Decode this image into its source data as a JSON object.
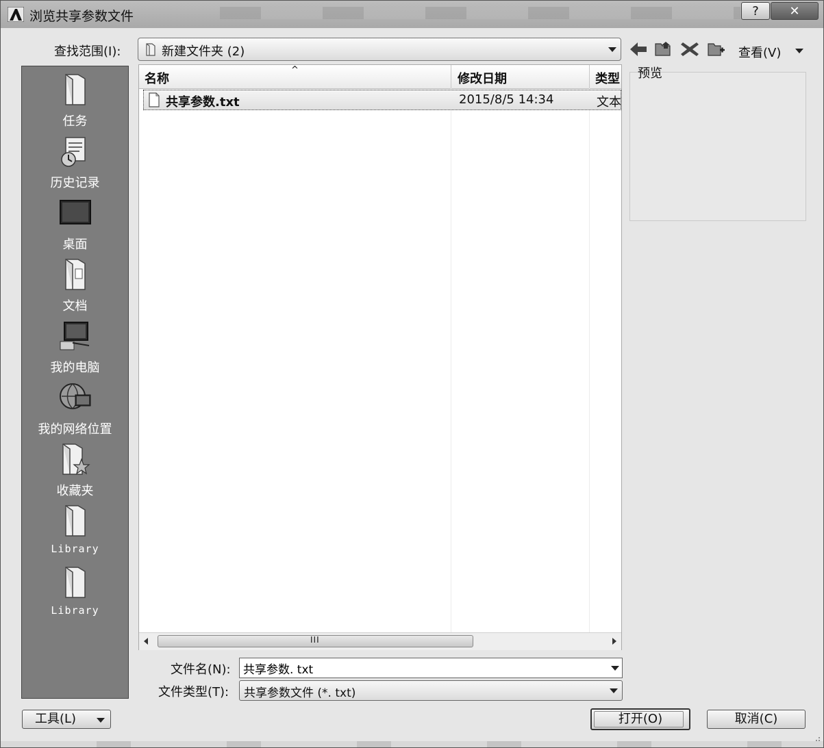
{
  "window": {
    "title": "浏览共享参数文件",
    "help_label": "?",
    "close_label": "✕"
  },
  "toolbar": {
    "look_in_label": "查找范围(I):",
    "look_in_value": "新建文件夹 (2)",
    "view_label": "查看(V)"
  },
  "places": [
    {
      "label": "任务",
      "icon": "folder-icon"
    },
    {
      "label": "历史记录",
      "icon": "history-icon"
    },
    {
      "label": "桌面",
      "icon": "desktop-icon"
    },
    {
      "label": "文档",
      "icon": "documents-icon"
    },
    {
      "label": "我的电脑",
      "icon": "computer-icon"
    },
    {
      "label": "我的网络位置",
      "icon": "network-icon"
    },
    {
      "label": "收藏夹",
      "icon": "favorites-icon"
    },
    {
      "label": "Library",
      "icon": "folder-icon"
    },
    {
      "label": "Library",
      "icon": "folder-icon"
    }
  ],
  "file_list": {
    "columns": [
      "名称",
      "修改日期",
      "类型"
    ],
    "rows": [
      {
        "name": "共享参数.txt",
        "modified": "2015/8/5 14:34",
        "type": "文本文档"
      }
    ],
    "scroll_grip": "III"
  },
  "preview": {
    "label": "预览"
  },
  "bottom": {
    "file_name_label": "文件名(N):",
    "file_name_value": "共享参数. txt",
    "file_type_label": "文件类型(T):",
    "file_type_value": "共享参数文件 (*. txt)"
  },
  "buttons": {
    "tools": "工具(L)",
    "open": "打开(O)",
    "cancel": "取消(C)"
  },
  "colors": {
    "places_bg": "#7d7d7d",
    "dialog_bg": "#e6e6e6"
  }
}
